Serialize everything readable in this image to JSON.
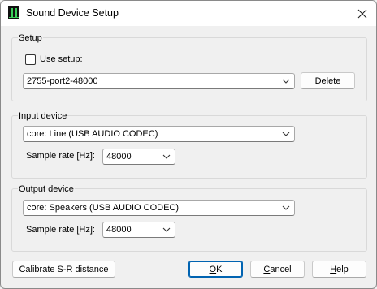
{
  "window": {
    "title": "Sound Device Setup"
  },
  "setup": {
    "group_label": "Setup",
    "use_setup_label": "Use setup:",
    "use_setup_checked": false,
    "setup_value": "2755-port2-48000",
    "delete_label": "Delete"
  },
  "input": {
    "group_label": "Input device",
    "device_value": "core: Line (USB AUDIO  CODEC)",
    "sample_rate_label": "Sample rate [Hz]:",
    "sample_rate_value": "48000"
  },
  "output": {
    "group_label": "Output device",
    "device_value": "core: Speakers (USB AUDIO  CODEC)",
    "sample_rate_label": "Sample rate [Hz]:",
    "sample_rate_value": "48000"
  },
  "buttons": {
    "calibrate_label": "Calibrate S-R distance",
    "ok_first": "O",
    "ok_rest": "K",
    "cancel_first": "C",
    "cancel_rest": "ancel",
    "help_first": "H",
    "help_rest": "elp"
  }
}
